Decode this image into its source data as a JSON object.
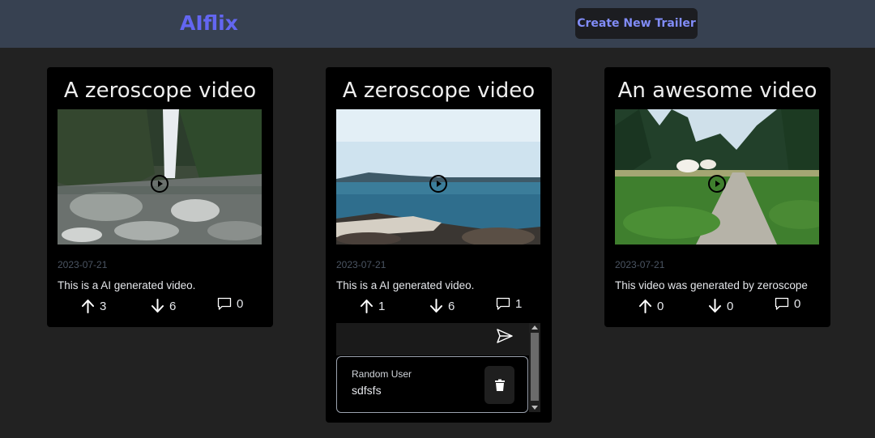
{
  "header": {
    "logo": "AIflix",
    "create_button": "Create New Trailer"
  },
  "cards": [
    {
      "title": "A zeroscope video",
      "date": "2023-07-21",
      "description": "This is a AI generated video.",
      "upvotes": "3",
      "downvotes": "6",
      "comments": "0"
    },
    {
      "title": "A zeroscope video",
      "date": "2023-07-21",
      "description": "This is a AI generated video.",
      "upvotes": "1",
      "downvotes": "6",
      "comments": "1",
      "comment_list": [
        {
          "user": "Random User",
          "text": "sdfsfs"
        }
      ]
    },
    {
      "title": "An awesome video",
      "date": "2023-07-21",
      "description": "This video was generated by zeroscope",
      "upvotes": "0",
      "downvotes": "0",
      "comments": "0"
    }
  ],
  "colors": {
    "accent": "#6366f1",
    "header_bg": "#374151",
    "page_bg": "#222222",
    "card_bg": "#000000"
  }
}
